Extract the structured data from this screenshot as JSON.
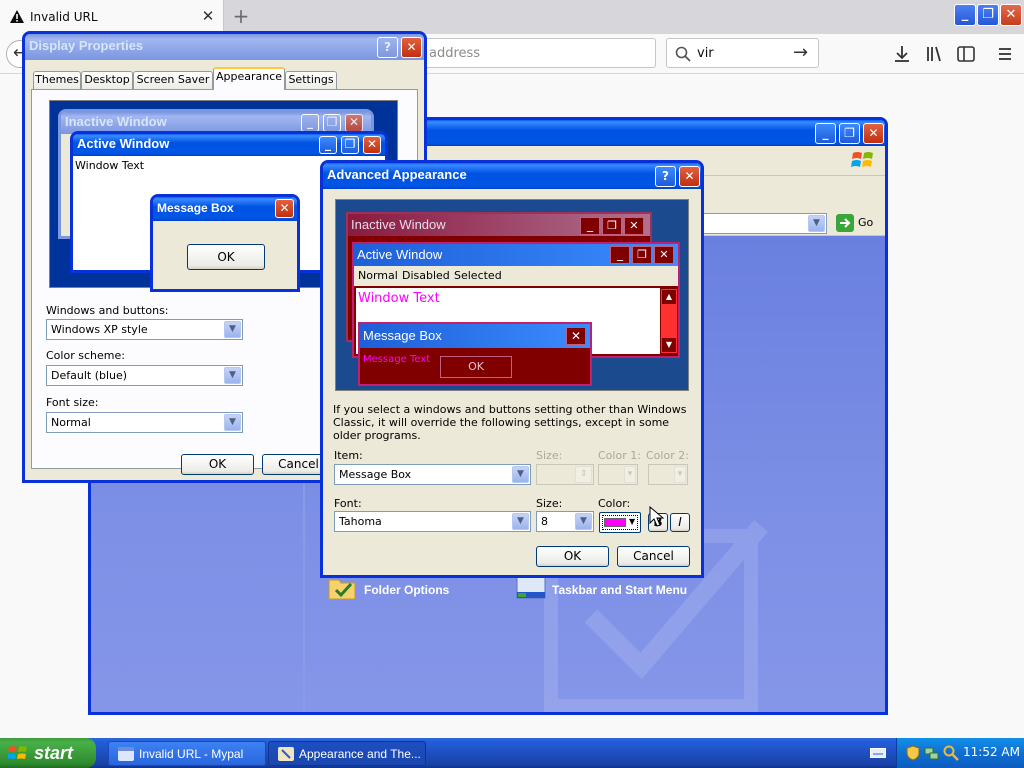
{
  "browser": {
    "tab_title": "Invalid URL",
    "tab_close": "✕",
    "new_tab": "+",
    "back": "←",
    "url_placeholder": "address",
    "search_value": "vir",
    "search_go": "→",
    "minimize": "_",
    "restore": "❐",
    "close": "✕"
  },
  "display_properties": {
    "title": "Display Properties",
    "help": "?",
    "close": "✕",
    "tabs": [
      "Themes",
      "Desktop",
      "Screen Saver",
      "Appearance",
      "Settings"
    ],
    "active_tab": "Appearance",
    "preview": {
      "inactive_window": "Inactive Window",
      "active_window": "Active Window",
      "window_text": "Window Text",
      "message_box": "Message Box",
      "ok": "OK"
    },
    "windows_buttons_label": "Windows and buttons:",
    "windows_buttons_value": "Windows XP style",
    "color_scheme_label": "Color scheme:",
    "color_scheme_value": "Default (blue)",
    "font_size_label": "Font size:",
    "font_size_value": "Normal",
    "ok": "OK",
    "cancel": "Cancel"
  },
  "advanced_appearance": {
    "title": "Advanced Appearance",
    "help": "?",
    "close": "✕",
    "preview": {
      "inactive_window": "Inactive Window",
      "active_window": "Active Window",
      "menu_items": [
        "Normal",
        "Disabled",
        "Selected"
      ],
      "window_text": "Window Text",
      "message_box": "Message Box",
      "message_text": "Message Text",
      "ok": "OK"
    },
    "info_text": "If you select a windows and buttons setting other than Windows Classic, it will override the following settings, except in some older programs.",
    "item_label": "Item:",
    "item_value": "Message Box",
    "size_label": "Size:",
    "color1_label": "Color 1:",
    "color2_label": "Color 2:",
    "font_label": "Font:",
    "font_value": "Tahoma",
    "font_size_label": "Size:",
    "font_size_value": "8",
    "font_color_label": "Color:",
    "font_color": "#ff00ff",
    "bold": "B",
    "italic": "I",
    "ok": "OK",
    "cancel": "Cancel"
  },
  "explorer": {
    "go": "Go",
    "folder_options": "Folder Options",
    "taskbar_start": "Taskbar and Start Menu"
  },
  "taskbar": {
    "start": "start",
    "tasks": [
      "Invalid URL - Mypal",
      "Appearance and The..."
    ],
    "clock": "11:52 AM"
  },
  "colors": {
    "xp_blue": "#0054e3",
    "xp_face": "#ece9d8",
    "preview_maroon": "#800000",
    "preview_magenta": "#ff00ff",
    "taskbar_blue": "#245edb",
    "start_green": "#3c9a3c"
  }
}
